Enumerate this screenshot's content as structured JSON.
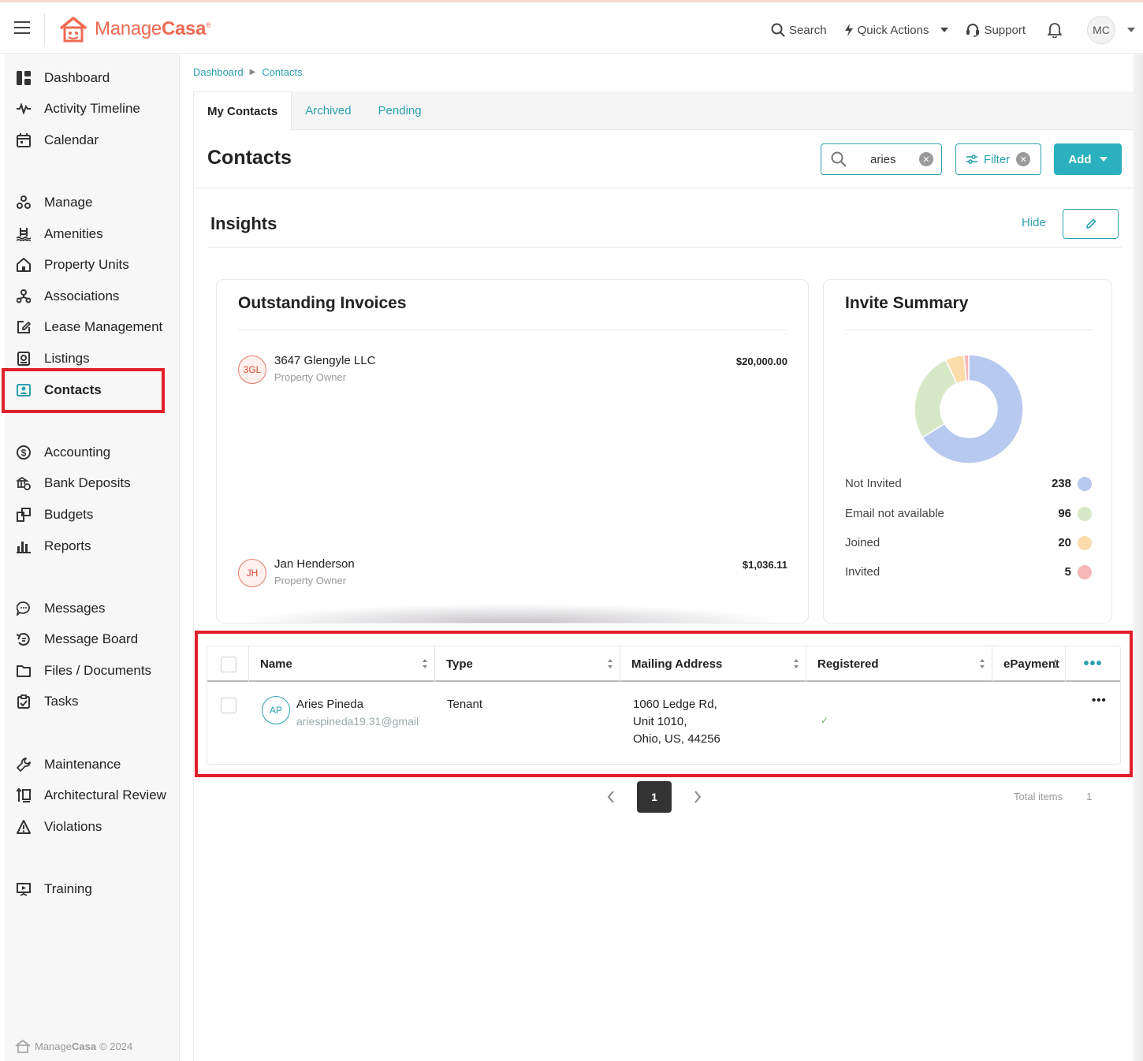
{
  "header": {
    "brand_name_light": "Manage",
    "brand_name_bold": "Casa",
    "search_label": "Search",
    "quick_actions_label": "Quick Actions",
    "support_label": "Support",
    "user_initials": "MC"
  },
  "sidebar": {
    "items": [
      {
        "label": "Dashboard",
        "icon": "dashboard-icon"
      },
      {
        "label": "Activity Timeline",
        "icon": "pulse-icon"
      },
      {
        "label": "Calendar",
        "icon": "calendar-icon"
      },
      {
        "label": "Manage",
        "icon": "manage-icon"
      },
      {
        "label": "Amenities",
        "icon": "pool-icon"
      },
      {
        "label": "Property Units",
        "icon": "home-icon"
      },
      {
        "label": "Associations",
        "icon": "hierarchy-icon"
      },
      {
        "label": "Lease Management",
        "icon": "edit-document-icon"
      },
      {
        "label": "Listings",
        "icon": "listing-icon"
      },
      {
        "label": "Contacts",
        "icon": "contact-card-icon"
      },
      {
        "label": "Accounting",
        "icon": "dollar-icon"
      },
      {
        "label": "Bank Deposits",
        "icon": "bank-deposit-icon"
      },
      {
        "label": "Budgets",
        "icon": "budget-icon"
      },
      {
        "label": "Reports",
        "icon": "bar-chart-icon"
      },
      {
        "label": "Messages",
        "icon": "chat-icon"
      },
      {
        "label": "Message Board",
        "icon": "message-board-icon"
      },
      {
        "label": "Files / Documents",
        "icon": "folder-icon"
      },
      {
        "label": "Tasks",
        "icon": "clipboard-icon"
      },
      {
        "label": "Maintenance",
        "icon": "wrench-icon"
      },
      {
        "label": "Architectural Review",
        "icon": "review-icon"
      },
      {
        "label": "Violations",
        "icon": "warning-icon"
      },
      {
        "label": "Training",
        "icon": "training-icon"
      }
    ],
    "active": "Contacts",
    "footer_brand_light": "Manage",
    "footer_brand_bold": "Casa",
    "footer_copyright": "© 2024"
  },
  "breadcrumb": {
    "items": [
      "Dashboard",
      "Contacts"
    ]
  },
  "tabs": [
    {
      "label": "My Contacts",
      "active": true
    },
    {
      "label": "Archived",
      "active": false
    },
    {
      "label": "Pending",
      "active": false
    }
  ],
  "toolbar": {
    "title": "Contacts",
    "search_value": "aries",
    "filter_label": "Filter",
    "add_label": "Add"
  },
  "insights": {
    "title": "Insights",
    "hide_label": "Hide"
  },
  "outstanding_invoices": {
    "title": "Outstanding Invoices",
    "rows": [
      {
        "initials": "3GL",
        "name": "3647 Glengyle LLC",
        "role": "Property Owner",
        "amount": "$20,000.00"
      },
      {
        "initials": "JH",
        "name": "Jan Henderson",
        "role": "Property Owner",
        "amount": "$1,036.11"
      }
    ]
  },
  "invite_summary": {
    "title": "Invite Summary",
    "rows": [
      {
        "label": "Not Invited",
        "value": "238",
        "color": "#b7c9ef"
      },
      {
        "label": "Email not available",
        "value": "96",
        "color": "#d7e8c6"
      },
      {
        "label": "Joined",
        "value": "20",
        "color": "#fbdcaa"
      },
      {
        "label": "Invited",
        "value": "5",
        "color": "#f6b7b7"
      }
    ]
  },
  "chart_data": {
    "type": "pie",
    "categories": [
      "Not Invited",
      "Email not available",
      "Joined",
      "Invited"
    ],
    "values": [
      238,
      96,
      20,
      5
    ],
    "colors": [
      "#b7c9ef",
      "#d7e8c6",
      "#fbdcaa",
      "#f6b7b7"
    ],
    "title": "Invite Summary",
    "donut": true
  },
  "table": {
    "columns": [
      "Name",
      "Type",
      "Mailing Address",
      "Registered",
      "ePayment"
    ],
    "rows": [
      {
        "initials": "AP",
        "name": "Aries Pineda",
        "email": "ariespineda19.31@gmail",
        "type": "Tenant",
        "address_line1": "1060 Ledge Rd,",
        "address_line2": "Unit 1010,",
        "address_line3": "Ohio, US, 44256",
        "registered": "✓",
        "epayment": ""
      }
    ]
  },
  "pagination": {
    "current_page": "1",
    "total_items_label": "Total items",
    "total_items": "1"
  }
}
